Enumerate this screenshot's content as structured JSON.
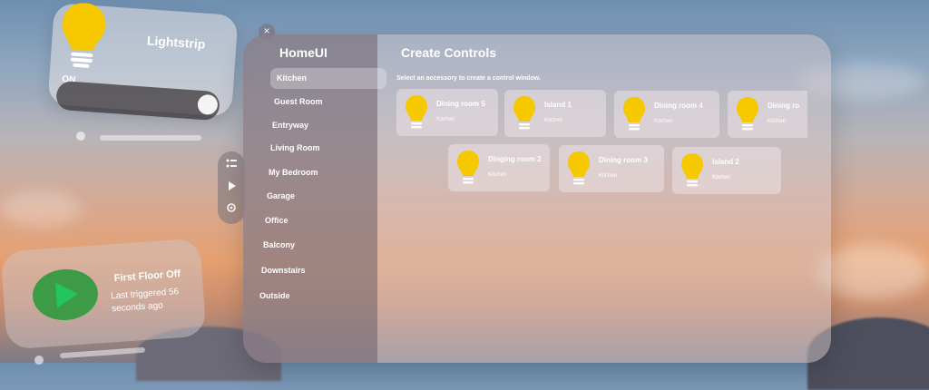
{
  "lightstrip": {
    "title": "Lightstrip",
    "state": "ON"
  },
  "window": {
    "close_label": "×"
  },
  "ornament": {
    "list_icon": "list-icon",
    "play_icon": "play-icon",
    "settings_icon": "gear-icon"
  },
  "app": {
    "title": "HomeUI",
    "sidebar": {
      "items": [
        {
          "label": "Kitchen"
        },
        {
          "label": "Guest Room"
        },
        {
          "label": "Entryway"
        },
        {
          "label": "Living Room"
        },
        {
          "label": "My Bedroom"
        },
        {
          "label": "Garage"
        },
        {
          "label": "Office"
        },
        {
          "label": "Balcony"
        },
        {
          "label": "Downstairs"
        },
        {
          "label": "Outside"
        }
      ]
    },
    "content": {
      "title": "Create Controls",
      "subtitle": "Select an accessory to create a control window.",
      "cards": [
        {
          "name": "Dining room 5",
          "room": "Kitchen"
        },
        {
          "name": "Island 1",
          "room": "Kitchen"
        },
        {
          "name": "Dining room 4",
          "room": "Kitchen"
        },
        {
          "name": "Dining ro",
          "room": "Kitchen"
        },
        {
          "name": "Dinging room 2",
          "room": "Kitchen"
        },
        {
          "name": "Dining room 3",
          "room": "Kitchen"
        },
        {
          "name": "Island 2",
          "room": "Kitchen"
        }
      ]
    }
  },
  "scene": {
    "title": "First Floor Off",
    "subtitle": "Last triggered 56 seconds ago"
  },
  "colors": {
    "bulb": "#f5c800",
    "play": "#3d9b45",
    "play_icon": "#22c55e"
  }
}
